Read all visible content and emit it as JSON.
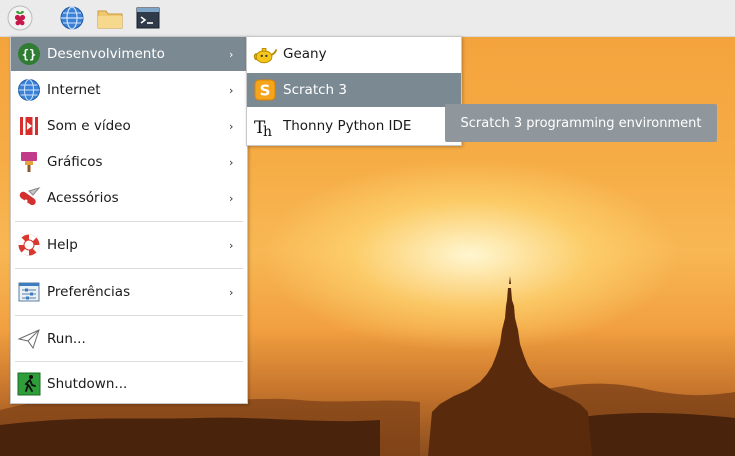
{
  "panel": {
    "launchers": [
      {
        "icon": "raspberry-pi-icon"
      },
      {
        "icon": "web-browser-icon"
      },
      {
        "icon": "file-manager-icon"
      },
      {
        "icon": "terminal-icon"
      }
    ]
  },
  "main_menu": {
    "items": [
      {
        "label": "Desenvolvimento",
        "icon": "development-icon",
        "has_submenu": true,
        "active": true
      },
      {
        "label": "Internet",
        "icon": "internet-globe-icon",
        "has_submenu": true
      },
      {
        "label": "Som e vídeo",
        "icon": "sound-video-icon",
        "has_submenu": true
      },
      {
        "label": "Gráficos",
        "icon": "graphics-brush-icon",
        "has_submenu": true
      },
      {
        "label": "Acessórios",
        "icon": "accessories-knife-icon",
        "has_submenu": true
      },
      {
        "label": "Help",
        "icon": "help-lifebuoy-icon",
        "has_submenu": true
      },
      {
        "label": "Preferências",
        "icon": "preferences-icon",
        "has_submenu": true
      },
      {
        "label": "Run...",
        "icon": "run-paper-plane-icon",
        "has_submenu": false
      },
      {
        "label": "Shutdown...",
        "icon": "shutdown-exit-icon",
        "has_submenu": false
      }
    ],
    "arrow_glyph": "›"
  },
  "sub_menu": {
    "items": [
      {
        "label": "Geany",
        "icon": "geany-teapot-icon"
      },
      {
        "label": "Scratch 3",
        "icon": "scratch-icon",
        "active": true
      },
      {
        "label": "Thonny Python IDE",
        "icon": "thonny-icon"
      }
    ]
  },
  "tooltip": {
    "text": "Scratch 3 programming environment"
  },
  "colors": {
    "active_bg": "#7b8993",
    "tooltip_bg": "#8f979c",
    "panel_bg": "#ebebeb"
  }
}
